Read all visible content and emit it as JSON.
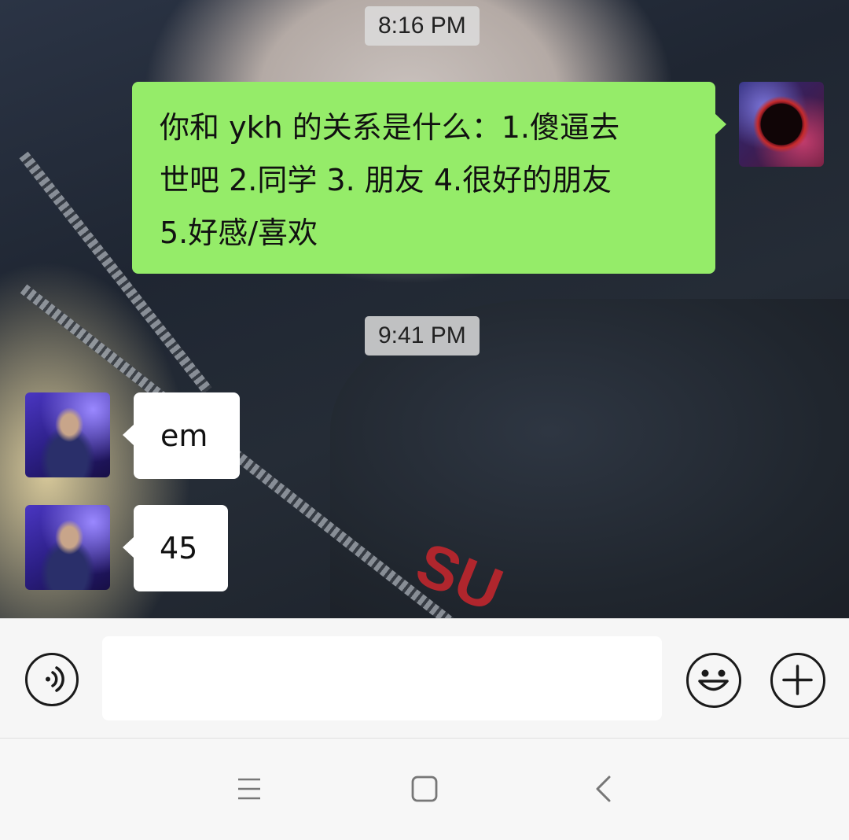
{
  "messages": [
    {
      "type": "timestamp",
      "text": "8:16 PM"
    },
    {
      "type": "outgoing",
      "sender": "self",
      "text": "你和 ykh 的关系是什么：1.傻逼去\n世吧 2.同学 3. 朋友 4.很好的朋友\n5.好感/喜欢"
    },
    {
      "type": "timestamp",
      "text": "9:41 PM"
    },
    {
      "type": "incoming",
      "sender": "contact",
      "text": "em"
    },
    {
      "type": "incoming",
      "sender": "contact",
      "text": "45"
    }
  ],
  "input_bar": {
    "voice_icon": "voice-icon",
    "message_value": "",
    "emoji_icon": "emoji-icon",
    "plus_icon": "plus-icon"
  },
  "nav_bar": {
    "menu_icon": "menu-icon",
    "home_icon": "home-icon",
    "back_icon": "back-icon"
  },
  "colors": {
    "outgoing_bubble": "#95ec69",
    "incoming_bubble": "#ffffff",
    "input_bar_bg": "#f6f6f6",
    "timestamp_bg": "#dcdcdc"
  }
}
